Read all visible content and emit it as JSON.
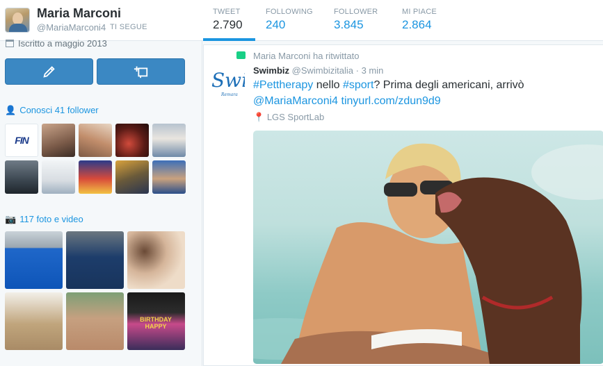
{
  "profile": {
    "name": "Maria Marconi",
    "screen_name": "@MariaMarconi4",
    "follows_you": "TI SEGUE",
    "joined": "Iscritto a maggio 2013"
  },
  "stats": [
    {
      "label": "TWEET",
      "value": "2.790",
      "active": true
    },
    {
      "label": "FOLLOWING",
      "value": "240",
      "active": false
    },
    {
      "label": "FOLLOWER",
      "value": "3.845",
      "active": false
    },
    {
      "label": "MI PIACE",
      "value": "2.864",
      "active": false
    }
  ],
  "actions": {
    "compose_icon": "compose-icon",
    "message_icon": "direct-message-icon"
  },
  "followers_section": {
    "title": "Conosci 41 follower",
    "icon": "user-icon",
    "fin_logo": "FIN"
  },
  "media_section": {
    "title": "117 foto e video",
    "icon": "camera-icon",
    "birthday_text": "BIRTHDAY HAPPY"
  },
  "tweet": {
    "retweeted_by": "Maria Marconi ha ritwittato",
    "author_name": "Swimbiz",
    "author_handle": "@Swimbizitalia",
    "separator": "·",
    "time": "3 min",
    "logo_text": "Swi",
    "logo_sub": "Remara",
    "text_parts": {
      "hashtag1": "#Pettherapy",
      "plain1": " nello ",
      "hashtag2": "#sport",
      "plain2": "? Prima degli americani, arrivò",
      "mention": "@MariaMarconi4",
      "space": " ",
      "link": "tinyurl.com/zdun9d9"
    },
    "location": "LGS SportLab"
  },
  "colors": {
    "accent": "#1b95e0",
    "button": "#3b88c3",
    "retweet": "#19cf86"
  }
}
